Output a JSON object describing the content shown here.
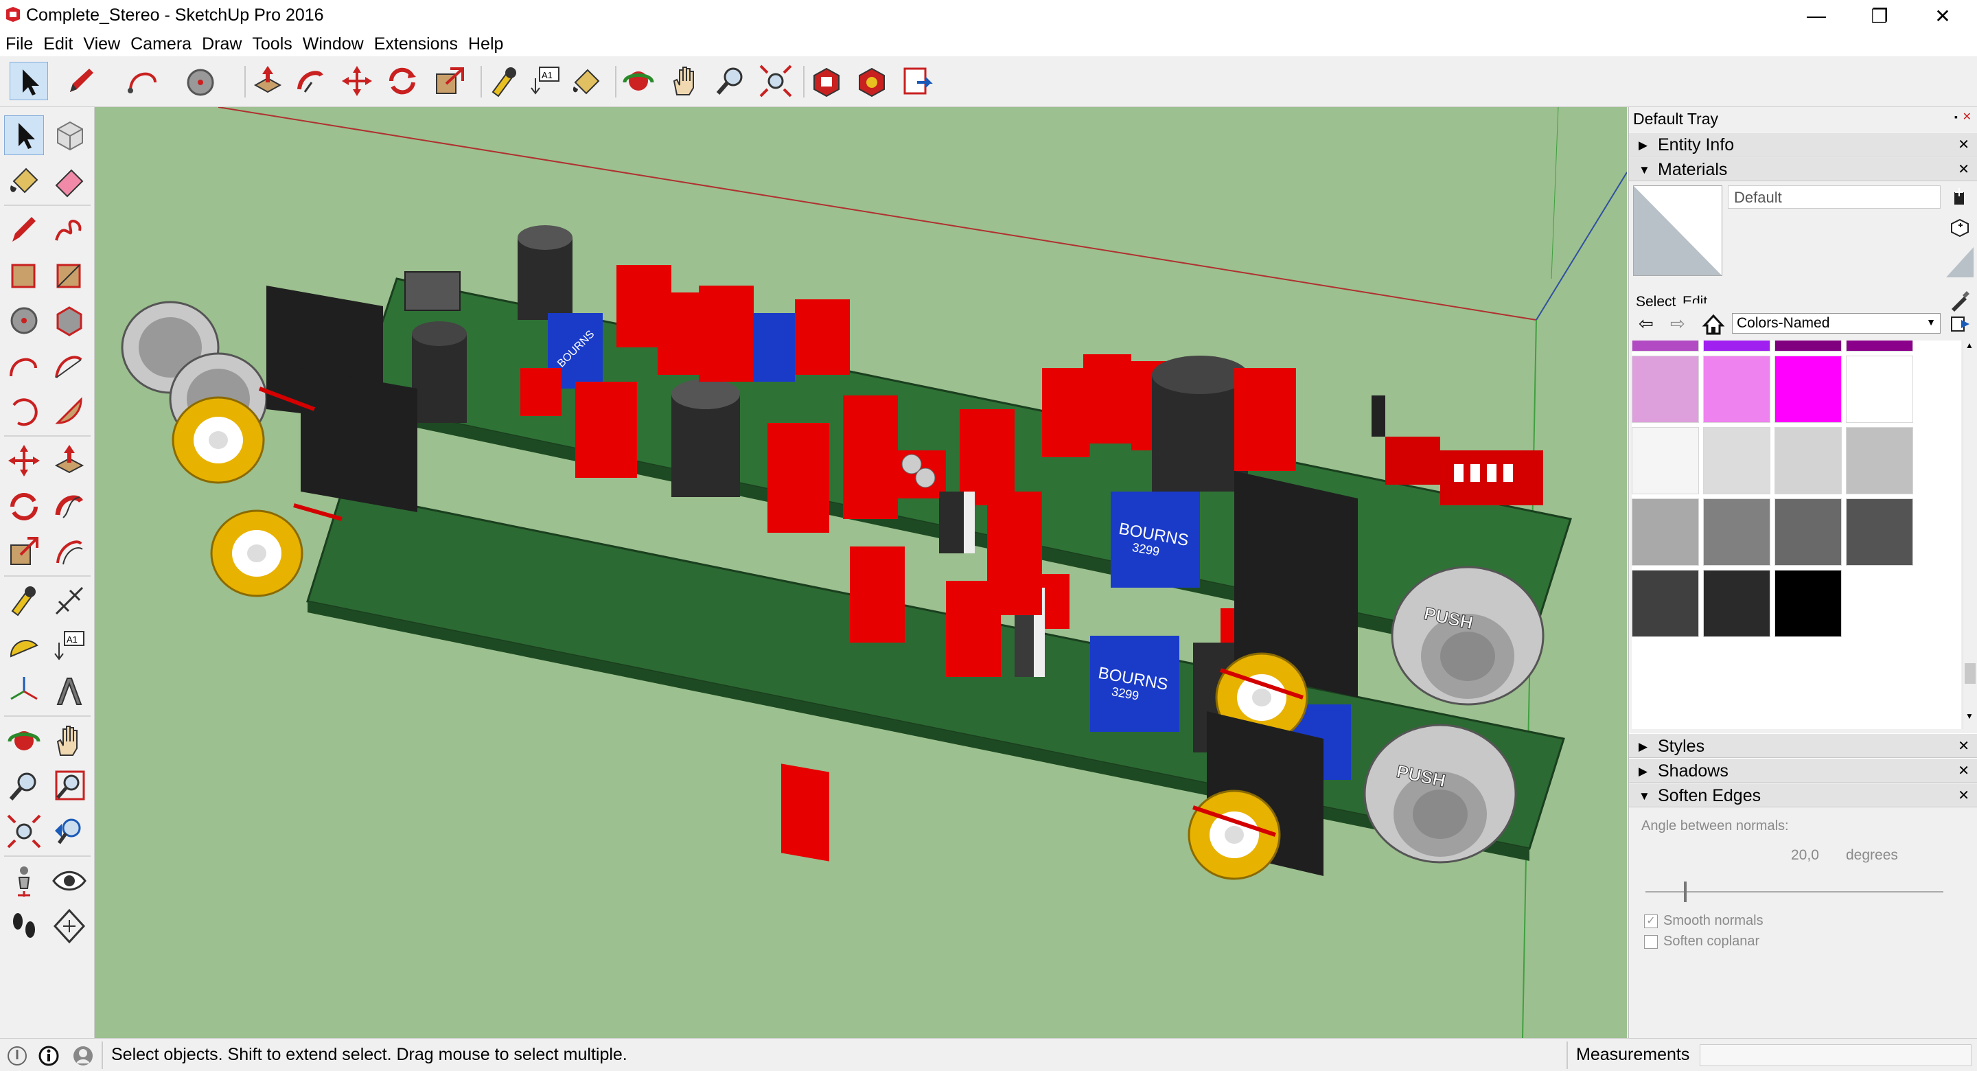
{
  "window": {
    "title": "Complete_Stereo - SketchUp Pro 2016",
    "minimize_glyph": "—",
    "maximize_glyph": "❐",
    "close_glyph": "✕"
  },
  "menu": [
    "File",
    "Edit",
    "View",
    "Camera",
    "Draw",
    "Tools",
    "Window",
    "Extensions",
    "Help"
  ],
  "toolbar": {
    "icons": [
      "select-arrow-icon",
      "pencil-icon",
      "arc-icon",
      "circle-icon",
      "push-pull-icon",
      "follow-me-icon",
      "move-icon",
      "rotate-icon",
      "scale-icon",
      "tape-measure-icon",
      "text-icon",
      "paint-bucket-icon",
      "orbit-icon",
      "pan-icon",
      "zoom-icon",
      "zoom-extents-icon",
      "warehouse-icon",
      "extension-warehouse-icon",
      "layout-send-icon"
    ]
  },
  "model": {
    "chip1_label": "BOURNS",
    "chip1_sub": "3299",
    "chip2_label": "BOURNS",
    "chip2_sub": "3299",
    "chip_small": "BOURNS",
    "xlr1_label": "PUSH",
    "xlr2_label": "PUSH"
  },
  "tray": {
    "title": "Default Tray",
    "panels": {
      "entity_info": "Entity Info",
      "materials": "Materials",
      "styles": "Styles",
      "shadows": "Shadows",
      "soften_edges": "Soften Edges"
    },
    "materials": {
      "current_name": "Default",
      "tab_select": "Select",
      "tab_edit": "Edit",
      "library": "Colors-Named",
      "swatches": [
        "#b24ac4",
        "#a020f0",
        "#800080",
        "#8b008b",
        "#dda0dd",
        "#ee82ee",
        "#ff00ff",
        "#ffffff",
        "#f5f5f5",
        "#dcdcdc",
        "#d3d3d3",
        "#c0c0c0",
        "#a9a9a9",
        "#808080",
        "#696969",
        "#545454",
        "#404040",
        "#2a2a2a",
        "#000000"
      ]
    },
    "soften": {
      "angle_label": "Angle between normals:",
      "angle_value": "20,0",
      "angle_unit": "degrees",
      "smooth_normals": "Smooth normals",
      "soften_coplanar": "Soften coplanar"
    }
  },
  "status": {
    "message": "Select objects. Shift to extend select. Drag mouse to select multiple.",
    "measurements_label": "Measurements"
  }
}
